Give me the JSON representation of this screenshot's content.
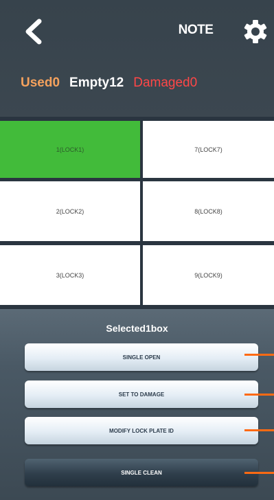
{
  "header": {
    "title": "NOTE",
    "back_icon": "chevron-left-icon",
    "settings_icon": "gear-icon"
  },
  "counts": {
    "used": "Used0",
    "empty": "Empty12",
    "damaged": "Damaged0",
    "colors": {
      "used": "#f5a25d",
      "empty": "#ffffff",
      "damaged": "#ff4747"
    }
  },
  "lockers": [
    {
      "label": "1(LOCK1)",
      "selected": true
    },
    {
      "label": "7(LOCK7)",
      "selected": false
    },
    {
      "label": "2(LOCK2)",
      "selected": false
    },
    {
      "label": "8(LOCK8)",
      "selected": false
    },
    {
      "label": "3(LOCK3)",
      "selected": false
    },
    {
      "label": "9(LOCK9)",
      "selected": false
    }
  ],
  "panel": {
    "selected_text": "Selected1box",
    "actions": [
      {
        "label": "SINGLE OPEN"
      },
      {
        "label": "SET TO DAMAGE"
      },
      {
        "label": "MODIFY LOCK PLATE ID"
      },
      {
        "label": "SINGLE CLEAN"
      }
    ]
  },
  "colors": {
    "selected_cell": "#42bb3a",
    "marker": "#ff6a13"
  }
}
